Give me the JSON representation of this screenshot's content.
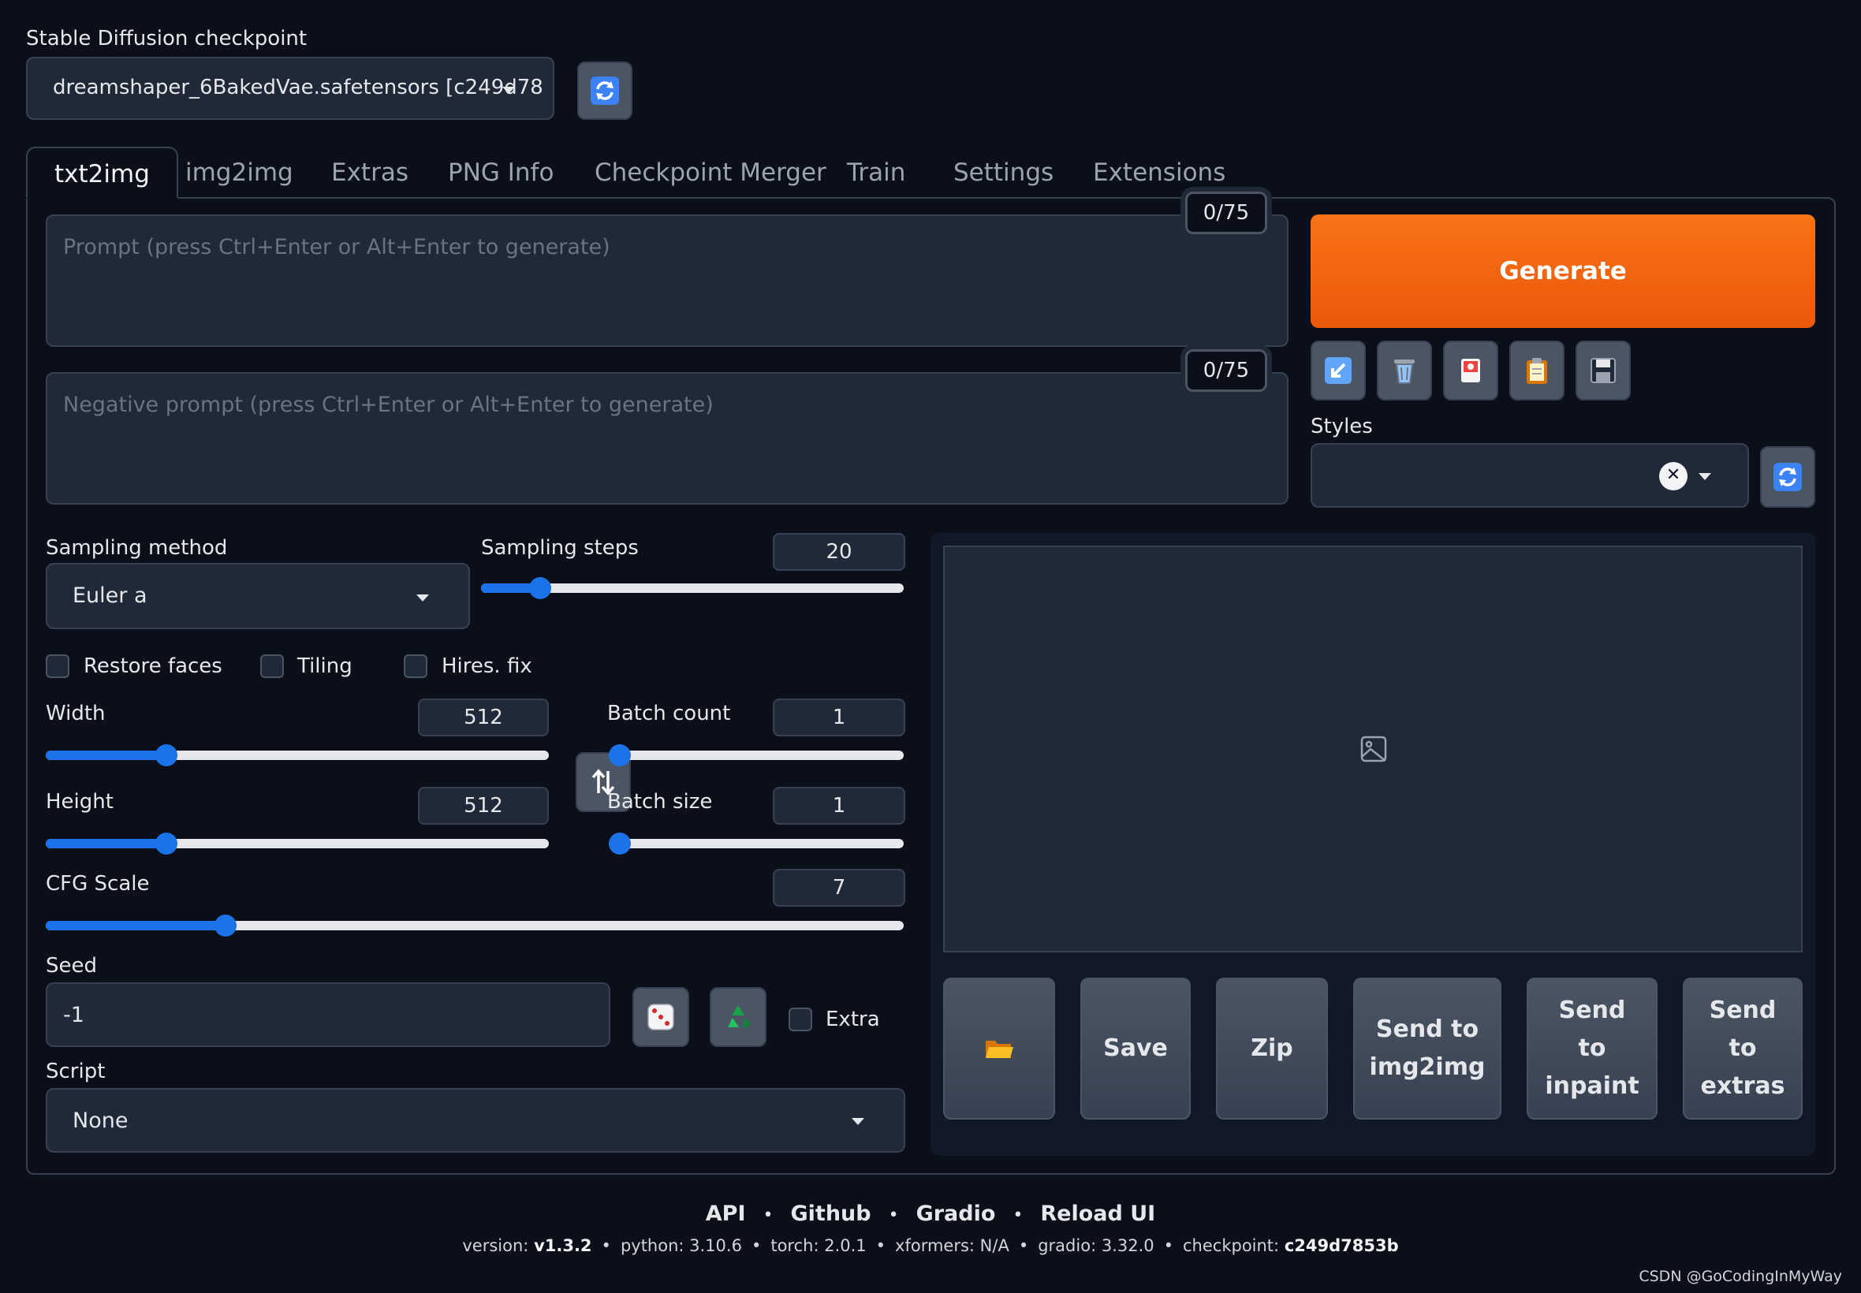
{
  "checkpoint": {
    "label": "Stable Diffusion checkpoint",
    "value": "dreamshaper_6BakedVae.safetensors [c249d78"
  },
  "tabs": [
    "txt2img",
    "img2img",
    "Extras",
    "PNG Info",
    "Checkpoint Merger",
    "Train",
    "Settings",
    "Extensions"
  ],
  "prompt": {
    "placeholder": "Prompt (press Ctrl+Enter or Alt+Enter to generate)",
    "counter": "0/75"
  },
  "negative_prompt": {
    "placeholder": "Negative prompt (press Ctrl+Enter or Alt+Enter to generate)",
    "counter": "0/75"
  },
  "generate_label": "Generate",
  "styles_label": "Styles",
  "sampling": {
    "method_label": "Sampling method",
    "method_value": "Euler a",
    "steps_label": "Sampling steps",
    "steps_value": "20",
    "steps_fraction": 0.14
  },
  "checkboxes": {
    "restore_faces": "Restore faces",
    "tiling": "Tiling",
    "hires_fix": "Hires. fix",
    "extra": "Extra"
  },
  "width": {
    "label": "Width",
    "value": "512",
    "fraction": 0.24
  },
  "height": {
    "label": "Height",
    "value": "512",
    "fraction": 0.24
  },
  "batch_count": {
    "label": "Batch count",
    "value": "1",
    "fraction": 0.0
  },
  "batch_size": {
    "label": "Batch size",
    "value": "1",
    "fraction": 0.0
  },
  "cfg": {
    "label": "CFG Scale",
    "value": "7",
    "fraction": 0.21
  },
  "seed": {
    "label": "Seed",
    "value": "-1"
  },
  "script": {
    "label": "Script",
    "value": "None"
  },
  "output_buttons": {
    "save": "Save",
    "zip": "Zip",
    "send_img2img": [
      "Send to",
      "img2img"
    ],
    "send_inpaint": [
      "Send",
      "to",
      "inpaint"
    ],
    "send_extras": [
      "Send",
      "to",
      "extras"
    ]
  },
  "footer": {
    "links": [
      "API",
      "Github",
      "Gradio",
      "Reload UI"
    ],
    "version_label": "version:",
    "version": "v1.3.2",
    "python": "python: 3.10.6",
    "torch": "torch: 2.0.1",
    "xformers": "xformers: N/A",
    "gradio": "gradio: 3.32.0",
    "checkpoint_label": "checkpoint:",
    "checkpoint": "c249d7853b"
  },
  "watermark": "CSDN @GoCodingInMyWay",
  "colors": {
    "accent": "#1a73e8",
    "generate": "#f97316",
    "background": "#0b0f19",
    "panel": "#1f2937"
  },
  "icons": [
    "refresh-icon",
    "arrow-icon",
    "trash-icon",
    "card-icon",
    "clipboard-icon",
    "save-icon",
    "swap-icon",
    "dice-icon",
    "recycle-icon",
    "folder-icon",
    "image-icon"
  ]
}
